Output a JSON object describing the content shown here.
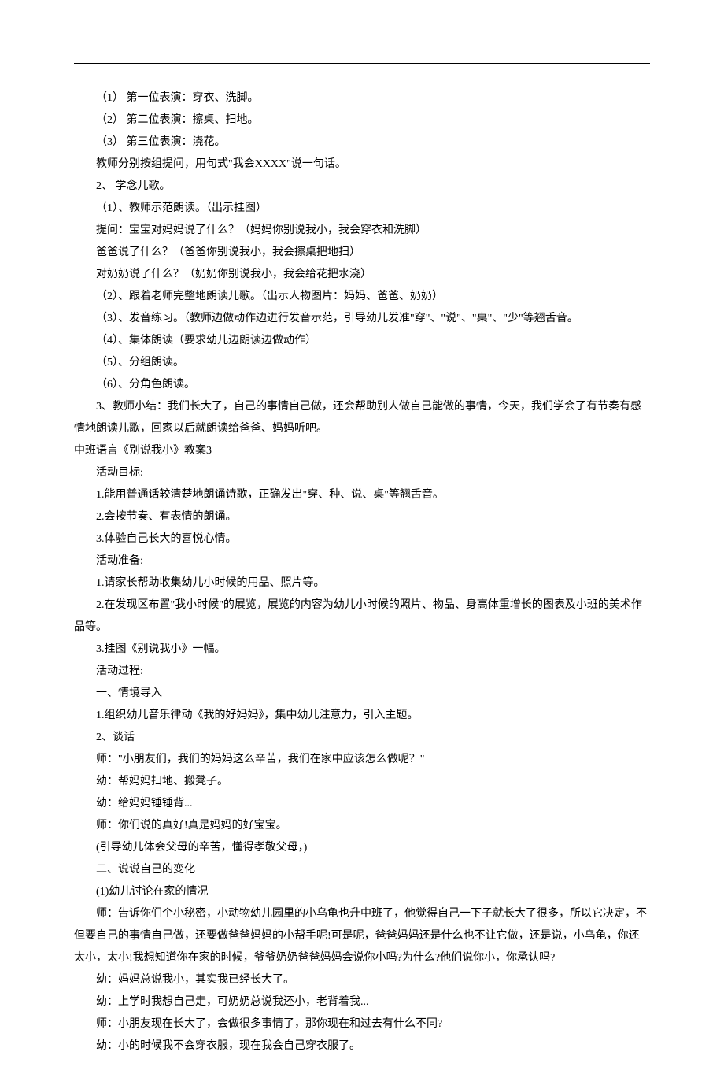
{
  "lines": [
    {
      "text": "（1） 第一位表演：穿衣、洗脚。",
      "indent": 2
    },
    {
      "text": "（2） 第二位表演：擦桌、扫地。",
      "indent": 2
    },
    {
      "text": "（3） 第三位表演：浇花。",
      "indent": 2
    },
    {
      "text": "教师分别按组提问，用句式\"我会XXXX\"说一句话。",
      "indent": 2
    },
    {
      "text": "2、 学念儿歌。",
      "indent": 2
    },
    {
      "text": "（1）、教师示范朗读。（出示挂图）",
      "indent": 2
    },
    {
      "text": "提问：宝宝对妈妈说了什么？（妈妈你别说我小，我会穿衣和洗脚）",
      "indent": 2
    },
    {
      "text": "爸爸说了什么？（爸爸你别说我小，我会擦桌把地扫）",
      "indent": 2
    },
    {
      "text": "对奶奶说了什么？（奶奶你别说我小，我会给花把水浇）",
      "indent": 2
    },
    {
      "text": "（2）、跟着老师完整地朗读儿歌。（出示人物图片：妈妈、爸爸、奶奶）",
      "indent": 2
    },
    {
      "text": "（3）、发音练习。（教师边做动作边进行发音示范，引导幼儿发准\"穿\"、\"说\"、\"桌\"、\"少\"等翘舌音。",
      "indent": 2
    },
    {
      "text": "（4）、集体朗读（要求幼儿边朗读边做动作）",
      "indent": 2
    },
    {
      "text": "（5）、分组朗读。",
      "indent": 2
    },
    {
      "text": "（6）、分角色朗读。",
      "indent": 2
    },
    {
      "text": "3、教师小结：我们长大了，自己的事情自己做，还会帮助别人做自己能做的事情，今天，我们学会了有节奏有感情地朗读儿歌，回家以后就朗读给爸爸、妈妈听吧。",
      "indent": 2
    },
    {
      "text": "中班语言《别说我小》教案3",
      "indent": 0
    },
    {
      "text": "活动目标:",
      "indent": 2
    },
    {
      "text": "1.能用普通话较清楚地朗诵诗歌，正确发出\"穿、种、说、桌\"等翘舌音。",
      "indent": 2
    },
    {
      "text": "2.会按节奏、有表情的朗诵。",
      "indent": 2
    },
    {
      "text": "3.体验自己长大的喜悦心情。",
      "indent": 2
    },
    {
      "text": "活动准备:",
      "indent": 2
    },
    {
      "text": "1.请家长帮助收集幼儿小时候的用品、照片等。",
      "indent": 2
    },
    {
      "text": "2.在发现区布置\"我小时候\"的展览，展览的内容为幼儿小时候的照片、物品、身高体重增长的图表及小班的美术作品等。",
      "indent": 2
    },
    {
      "text": "3.挂图《别说我小》一幅。",
      "indent": 2
    },
    {
      "text": "活动过程:",
      "indent": 2
    },
    {
      "text": "一、情境导入",
      "indent": 2
    },
    {
      "text": "1.组织幼儿音乐律动《我的好妈妈》，集中幼儿注意力，引入主题。",
      "indent": 2
    },
    {
      "text": "2、谈话",
      "indent": 2
    },
    {
      "text": "师：\"小朋友们，我们的妈妈这么辛苦，我们在家中应该怎么做呢？\"",
      "indent": 2
    },
    {
      "text": "幼：帮妈妈扫地、搬凳子。",
      "indent": 2
    },
    {
      "text": "幼：给妈妈锤锤背...",
      "indent": 2
    },
    {
      "text": "师：你们说的真好!真是妈妈的好宝宝。",
      "indent": 2
    },
    {
      "text": "(引导幼儿体会父母的辛苦，懂得孝敬父母，)",
      "indent": 2
    },
    {
      "text": "二、说说自己的变化",
      "indent": 2
    },
    {
      "text": "(1)幼儿讨论在家的情况",
      "indent": 2
    },
    {
      "text": "师：告诉你们个小秘密，小动物幼儿园里的小乌龟也升中班了，他觉得自己一下子就长大了很多，所以它决定，不但要自己的事情自己做，还要做爸爸妈妈的小帮手呢!可是呢，爸爸妈妈还是什么也不让它做，还是说，小乌龟，你还太小，太小!我想知道你在家的时候，爷爷奶奶爸爸妈妈会说你小吗?为什么?他们说你小，你承认吗?",
      "indent": 2
    },
    {
      "text": "幼：妈妈总说我小，其实我已经长大了。",
      "indent": 2
    },
    {
      "text": "幼：上学时我想自己走，可奶奶总说我还小，老背着我...",
      "indent": 2
    },
    {
      "text": "师：小朋友现在长大了，会做很多事情了，那你现在和过去有什么不同?",
      "indent": 2
    },
    {
      "text": "幼：小的时候我不会穿衣服，现在我会自己穿衣服了。",
      "indent": 2
    }
  ]
}
